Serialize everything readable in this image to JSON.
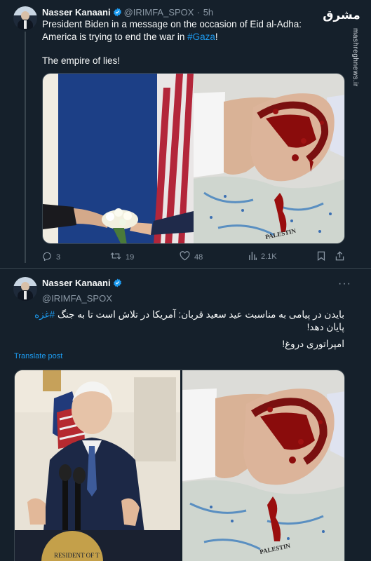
{
  "tweet1": {
    "author_name": "Nasser Kanaani",
    "handle": "@IRIMFA_SPOX",
    "separator": "·",
    "time": "5h",
    "text_before_hashtag": "President Biden in a message on the occasion of Eid al-Adha: America is trying to end the war in ",
    "hashtag": "#Gaza",
    "text_after_hashtag": "!",
    "text_line2": "The empire of lies!",
    "media_alt": "Composite: Biden handing flowers; handshake with bloodied hand over map of Palestine",
    "map_label": "PALESTIN",
    "actions": {
      "replies": "3",
      "retweets": "19",
      "likes": "48",
      "views": "2.1K"
    }
  },
  "tweet2": {
    "author_name": "Nasser Kanaani",
    "handle": "@IRIMFA_SPOX",
    "more": "···",
    "text_fa_before": "بایدن در پیامی به مناسبت عید سعید قربان: آمریکا در تلاش است تا به جنگ ",
    "hashtag_fa": "#غزه",
    "text_fa_after": " پایان دهد!",
    "text_fa_line2": "امپراتوری دروغ!",
    "translate_label": "Translate post",
    "media_alt": "Composite: Biden at podium; bloodied handshake over map",
    "seal_text": "RESIDENT OF T",
    "map_label": "PALESTIN"
  },
  "watermark": {
    "logo": "مشرق",
    "url": "mashreghnews.ir"
  },
  "colors": {
    "background": "#15202b",
    "text": "#f7f9f9",
    "muted": "#8b98a5",
    "accent": "#1d9bf0",
    "border": "#38444d"
  }
}
